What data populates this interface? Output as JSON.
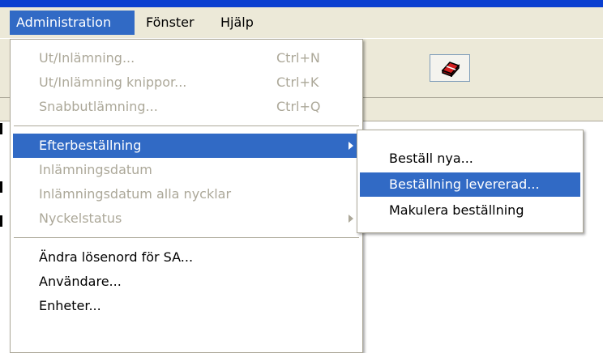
{
  "menubar": {
    "items": [
      {
        "label": "Administration"
      },
      {
        "label": "Fönster"
      },
      {
        "label": "Hjälp"
      }
    ]
  },
  "toolbar": {
    "button_icon": "eraser-icon"
  },
  "admin_menu": {
    "items": [
      {
        "label": "Ut/Inlämning...",
        "shortcut": "Ctrl+N",
        "state": "disabled"
      },
      {
        "label": "Ut/Inlämning knippor...",
        "shortcut": "Ctrl+K",
        "state": "disabled"
      },
      {
        "label": "Snabbutlämning...",
        "shortcut": "Ctrl+Q",
        "state": "disabled"
      },
      {
        "label": "Efterbeställning",
        "state": "selected",
        "submenu": true
      },
      {
        "label": "Inlämningsdatum",
        "state": "disabled"
      },
      {
        "label": "Inlämningsdatum alla nycklar",
        "state": "disabled"
      },
      {
        "label": "Nyckelstatus",
        "state": "disabled",
        "submenu": true
      },
      {
        "label": "Ändra lösenord för SA...",
        "state": "enabled"
      },
      {
        "label": "Användare...",
        "state": "enabled"
      },
      {
        "label": "Enheter...",
        "state": "enabled"
      }
    ]
  },
  "submenu": {
    "items": [
      {
        "label": "Beställ nya...",
        "state": "enabled"
      },
      {
        "label": "Beställning levererad...",
        "state": "selected"
      },
      {
        "label": "Makulera beställning",
        "state": "enabled"
      }
    ]
  },
  "colors": {
    "highlight": "#316ac5",
    "menubar_bg": "#ece9d8",
    "disabled_text": "#aca899"
  }
}
